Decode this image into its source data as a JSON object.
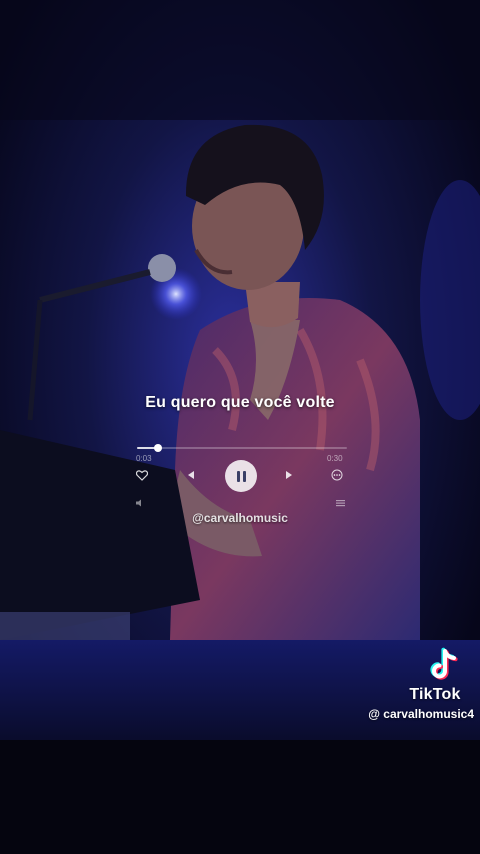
{
  "lyric": "Eu quero que você volte",
  "player": {
    "time_elapsed": "0:03",
    "time_total": "0:30",
    "progress_fraction": 0.1,
    "state": "playing"
  },
  "source_handle": "@carvalhomusic",
  "watermark": {
    "brand": "TikTok",
    "user": "@ carvalhomusic4"
  },
  "icons": [
    "heart-icon",
    "previous-icon",
    "pause-icon",
    "next-icon",
    "more-icon",
    "tiktok-logo-icon"
  ],
  "colors": {
    "background": "#07071a",
    "stage_light": "#2a2fd0",
    "tiktok_cyan": "#25f4ee",
    "tiktok_red": "#fe2c55"
  }
}
